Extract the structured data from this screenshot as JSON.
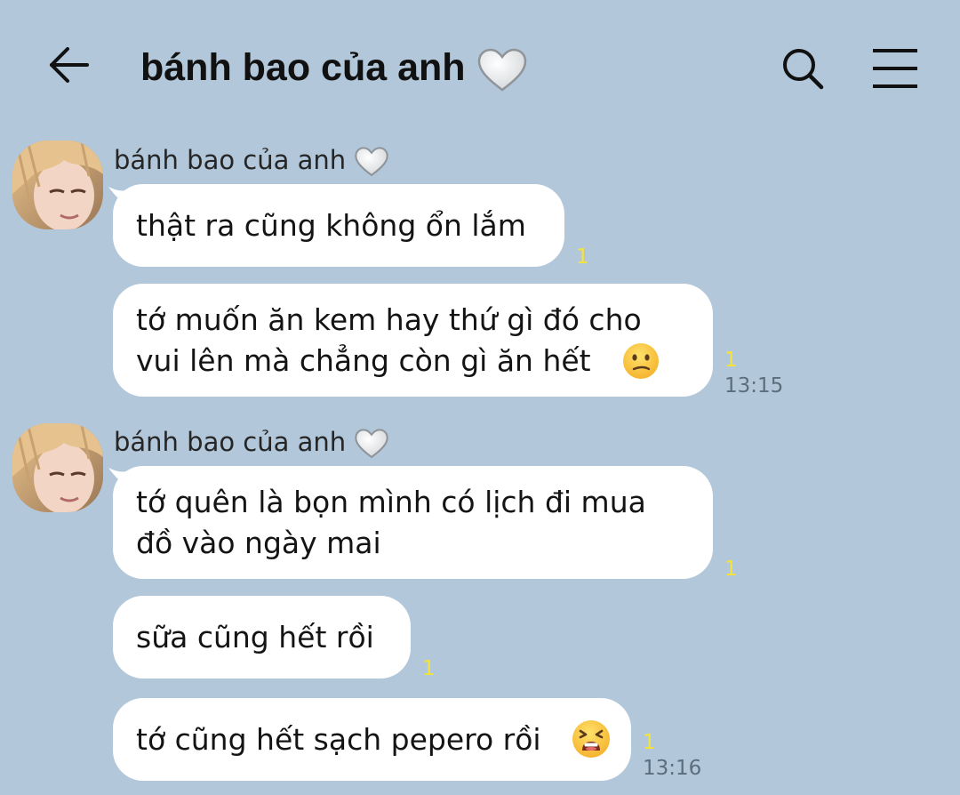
{
  "header": {
    "title": "bánh bao của anh"
  },
  "messages": [
    {
      "sender": "bánh bao của anh",
      "bubbles": [
        {
          "text": "thật ra cũng không ổn lắm",
          "unread": "1"
        },
        {
          "text": "tớ muốn ăn kem hay thứ gì đó cho\nvui lên mà chẳng còn gì ăn hết",
          "unread": "1",
          "time": "13:15",
          "emoji": "confused-face"
        }
      ]
    },
    {
      "sender": "bánh bao của anh",
      "bubbles": [
        {
          "text": "tớ quên là bọn mình có lịch đi mua\nđồ vào ngày mai",
          "unread": "1"
        },
        {
          "text": "sữa cũng hết rồi",
          "unread": "1"
        },
        {
          "text": "tớ cũng hết sạch pepero rồi",
          "unread": "1",
          "time": "13:16",
          "emoji": "tired-face"
        }
      ]
    }
  ],
  "colors": {
    "background": "#b2c7d9",
    "bubble": "#ffffff",
    "unread": "#f5e33a",
    "time": "#5b6e7d"
  }
}
